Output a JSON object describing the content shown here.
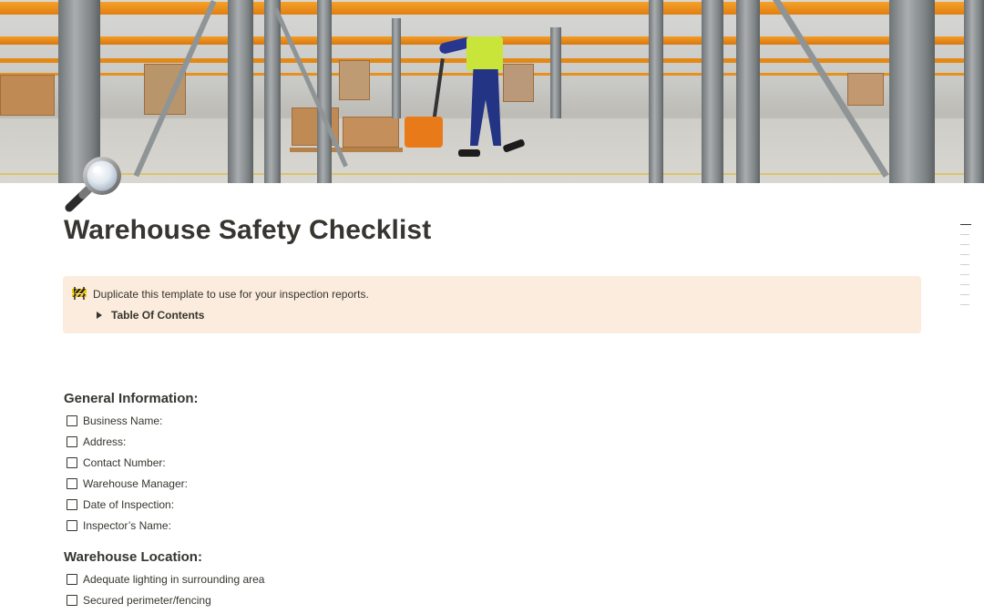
{
  "page": {
    "title": "Warehouse Safety Checklist",
    "icon": "magnifying-glass-icon"
  },
  "callout": {
    "icon": "construction-barrier-icon",
    "text": "Duplicate this template to use for your inspection reports.",
    "toggle_label": "Table Of Contents"
  },
  "sections": [
    {
      "heading": "General Information:",
      "items": [
        {
          "label": "Business Name:",
          "checked": false
        },
        {
          "label": "Address:",
          "checked": false
        },
        {
          "label": "Contact Number:",
          "checked": false
        },
        {
          "label": "Warehouse Manager:",
          "checked": false
        },
        {
          "label": "Date of Inspection:",
          "checked": false
        },
        {
          "label": "Inspector’s Name:",
          "checked": false
        }
      ]
    },
    {
      "heading": "Warehouse Location:",
      "items": [
        {
          "label": "Adequate lighting in surrounding area",
          "checked": false
        },
        {
          "label": "Secured perimeter/fencing",
          "checked": false
        }
      ]
    }
  ],
  "colors": {
    "text": "#37352f",
    "callout_bg": "#fbecdd",
    "rack_orange": "#f39c26"
  }
}
